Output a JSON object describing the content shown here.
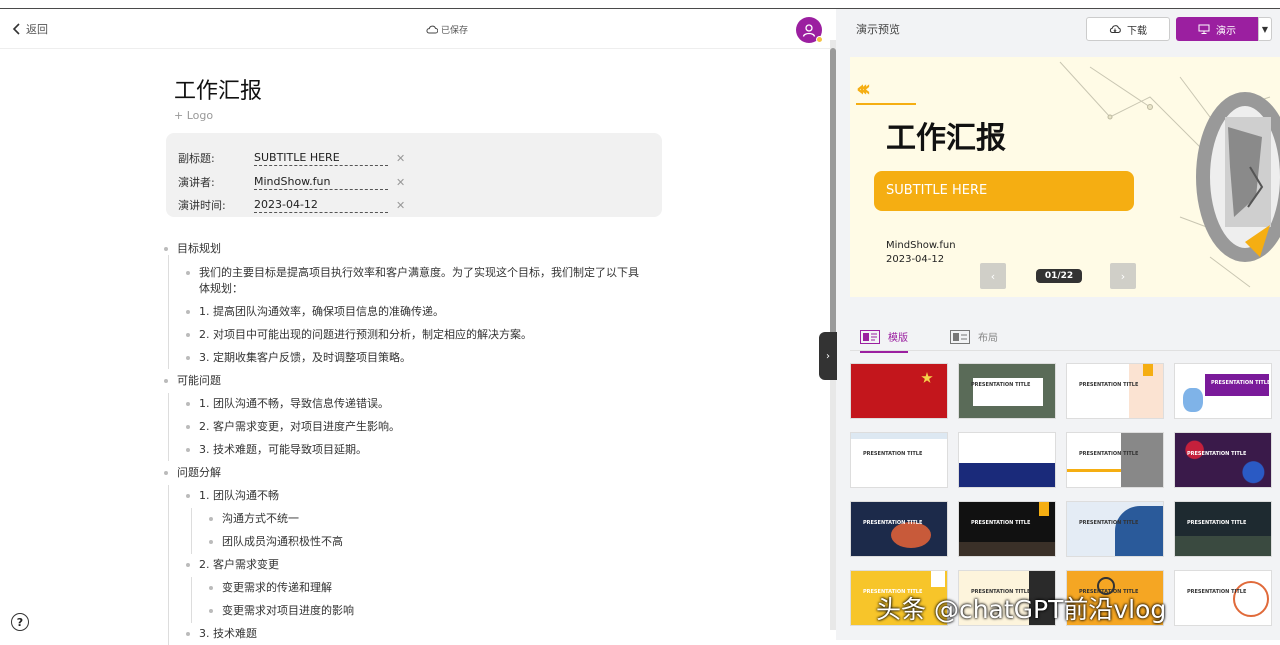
{
  "header": {
    "back_label": "返回",
    "saved_label": "已保存"
  },
  "document": {
    "title": "工作汇报",
    "logo_link": "+ Logo",
    "meta": [
      {
        "label": "副标题:",
        "value": "SUBTITLE HERE"
      },
      {
        "label": "演讲者:",
        "value": "MindShow.fun"
      },
      {
        "label": "演讲时间:",
        "value": "2023-04-12"
      }
    ],
    "outline": [
      {
        "text": "目标规划"
      },
      {
        "text": "我们的主要目标是提高项目执行效率和客户满意度。为了实现这个目标，我们制定了以下具"
      },
      {
        "text": "体规划："
      },
      {
        "text": "1. 提高团队沟通效率，确保项目信息的准确传递。"
      },
      {
        "text": "2. 对项目中可能出现的问题进行预测和分析，制定相应的解决方案。"
      },
      {
        "text": "3. 定期收集客户反馈，及时调整项目策略。"
      },
      {
        "text": "可能问题"
      },
      {
        "text": "1. 团队沟通不畅，导致信息传递错误。"
      },
      {
        "text": "2. 客户需求变更，对项目进度产生影响。"
      },
      {
        "text": "3. 技术难题，可能导致项目延期。"
      },
      {
        "text": "问题分解"
      },
      {
        "text": "1. 团队沟通不畅"
      },
      {
        "text": "沟通方式不统一"
      },
      {
        "text": "团队成员沟通积极性不高"
      },
      {
        "text": "2. 客户需求变更"
      },
      {
        "text": "变更需求的传递和理解"
      },
      {
        "text": "变更需求对项目进度的影响"
      },
      {
        "text": "3. 技术难题"
      }
    ]
  },
  "preview": {
    "title": "演示预览",
    "download_label": "下载",
    "play_label": "演示",
    "slide": {
      "title": "工作汇报",
      "subtitle": "SUBTITLE HERE",
      "author": "MindShow.fun",
      "date": "2023-04-12",
      "pager": "01/22"
    },
    "tabs": [
      {
        "label": "模版"
      },
      {
        "label": "布局"
      }
    ],
    "templates": [
      {
        "title": "",
        "bg": "#c3161c",
        "fg": "#f5d24a"
      },
      {
        "title": "PRESENTATION TITLE",
        "bg": "#5a6b58",
        "fg": "#333"
      },
      {
        "title": "PRESENTATION TITLE",
        "bg": "#ffffff",
        "fg": "#333"
      },
      {
        "title": "PRESENTATION TITLE",
        "bg": "#ffffff",
        "fg": "#fff"
      },
      {
        "title": "PRESENTATION TITLE",
        "bg": "#ffffff",
        "fg": "#333"
      },
      {
        "title": "PRESENTATION TITLE",
        "bg": "#ffffff",
        "fg": "#fff"
      },
      {
        "title": "PRESENTATION TITLE",
        "bg": "#ffffff",
        "fg": "#333"
      },
      {
        "title": "PRESENTATION TITLE",
        "bg": "#3a1a4a",
        "fg": "#fff"
      },
      {
        "title": "PRESENTATION TITLE",
        "bg": "#1c2a4a",
        "fg": "#fff"
      },
      {
        "title": "PRESENTATION TITLE",
        "bg": "#111111",
        "fg": "#fff"
      },
      {
        "title": "PRESENTATION TITLE",
        "bg": "#e4ecf5",
        "fg": "#333"
      },
      {
        "title": "PRESENTATION TITLE",
        "bg": "#1e2a30",
        "fg": "#fff"
      },
      {
        "title": "PRESENTATION TITLE",
        "bg": "#f7c52a",
        "fg": "#fff"
      },
      {
        "title": "PRESENTATION TITLE",
        "bg": "#fdf4dc",
        "fg": "#333"
      },
      {
        "title": "PRESENTATION TITLE",
        "bg": "#f5a623",
        "fg": "#333"
      },
      {
        "title": "PRESENTATION TITLE",
        "bg": "#ffffff",
        "fg": "#333"
      }
    ]
  },
  "watermark": "头条 @chatGPT前沿vlog",
  "colors": {
    "accent": "#9b1fa0",
    "slide_orange": "#f5ae12"
  }
}
